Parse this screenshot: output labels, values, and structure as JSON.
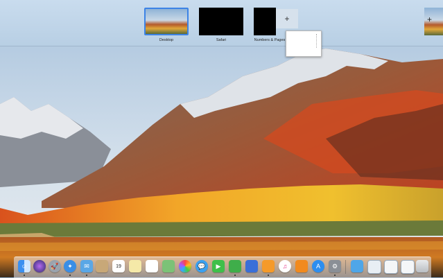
{
  "spaces": [
    {
      "label": "Desktop",
      "selected": true
    },
    {
      "label": "Safari",
      "selected": false
    },
    {
      "label": "Numbers & Pages",
      "selected": false
    }
  ],
  "add_space_symbol": "+",
  "right_add_symbol": "+",
  "calendar_day": "19",
  "dock_icons": [
    "finder-icon",
    "siri-icon",
    "launchpad-icon",
    "safari-icon",
    "mail-icon",
    "contacts-icon",
    "calendar-icon",
    "notes-icon",
    "reminders-icon",
    "maps-icon",
    "photos-icon",
    "messages-icon",
    "facetime-icon",
    "numbers-icon",
    "keynote-icon",
    "pages-icon",
    "itunes-icon",
    "ibooks-icon",
    "app-store-icon",
    "system-preferences-icon",
    "downloads-folder-icon",
    "screenshot-icon",
    "window-icon",
    "window2-icon",
    "trash-icon"
  ],
  "colors": {
    "selection_border": "#3c83e6",
    "spaces_bar": "#c9dcee",
    "autumn_orange": "#e07a1f",
    "autumn_yellow": "#f0b62a"
  }
}
